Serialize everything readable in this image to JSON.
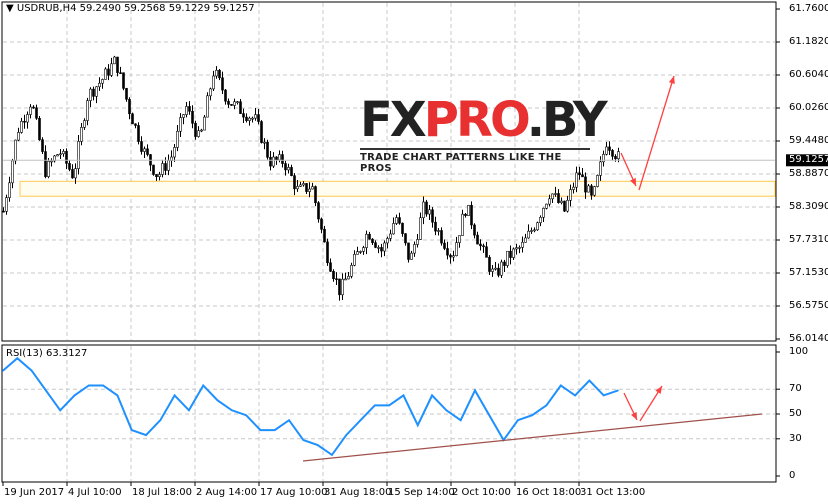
{
  "header": {
    "symbol": "USDRUB,H4",
    "ohlc": "59.2490 59.2568 59.1229 59.1257"
  },
  "logo": {
    "text": "FXPRO.BY",
    "tagline": "TRADE CHART PATTERNS LIKE THE PROS"
  },
  "colors": {
    "candle": "#000000",
    "rsi_line": "#1e90ff",
    "arrow": "#ff4040",
    "trendline": "#a0504a",
    "zone": "#ffc850",
    "grid": "#c8c8c8"
  },
  "chart_data": [
    {
      "type": "candlestick",
      "title": "USDRUB,H4",
      "ylim": [
        56.014,
        61.76
      ],
      "y_ticks": [
        "61.7600",
        "61.1820",
        "60.6040",
        "60.0260",
        "59.4480",
        "58.8870",
        "58.3090",
        "57.7310",
        "57.1530",
        "56.5750",
        "56.0140"
      ],
      "current_price": "59.1257",
      "x_ticks": [
        "19 Jun 2017",
        "4 Jul 10:00",
        "18 Jul 18:00",
        "2 Aug 14:00",
        "17 Aug 10:00",
        "31 Aug 18:00",
        "15 Sep 14:00",
        "2 Oct 10:00",
        "16 Oct 18:00",
        "31 Oct 13:00"
      ],
      "price_path": [
        58.24,
        59.64,
        60.17,
        58.94,
        59.29,
        58.85,
        60.25,
        60.52,
        60.87,
        59.99,
        59.29,
        58.85,
        59.2,
        60.08,
        59.46,
        60.69,
        60.17,
        59.99,
        59.82,
        59.11,
        59.11,
        58.59,
        58.68,
        57.54,
        56.84,
        57.36,
        57.89,
        57.54,
        58.15,
        57.36,
        58.33,
        57.89,
        57.45,
        58.33,
        57.63,
        57.1,
        57.45,
        57.63,
        58.06,
        58.59,
        58.24,
        58.94,
        58.41,
        59.46,
        59.13
      ],
      "support_zone": [
        58.5,
        58.76
      ],
      "grid": true
    },
    {
      "type": "line",
      "title": "RSI(13) 63.3127",
      "ylim": [
        0,
        100
      ],
      "y_ticks": [
        "100",
        "70",
        "50",
        "30",
        "0"
      ],
      "values": [
        85,
        95,
        85,
        69,
        53,
        65,
        73,
        73,
        65,
        37,
        33,
        45,
        65,
        53,
        73,
        61,
        53,
        49,
        37,
        37,
        45,
        29,
        25,
        17,
        33,
        45,
        57,
        57,
        65,
        41,
        65,
        53,
        45,
        69,
        49,
        29,
        45,
        49,
        57,
        73,
        65,
        77,
        65,
        69
      ],
      "grid": true
    }
  ]
}
